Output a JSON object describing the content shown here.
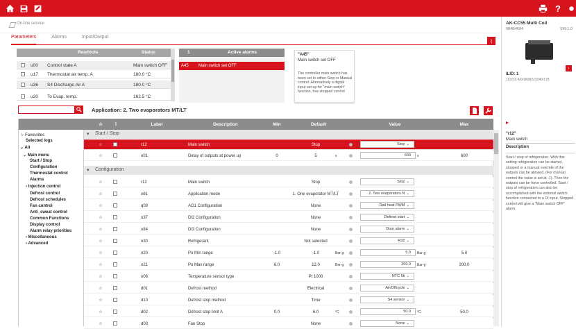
{
  "service_title": "On-line service",
  "tabs": [
    "Parameters",
    "Alarms",
    "Input/Output"
  ],
  "readouts": {
    "headers": [
      "Readouts",
      "Status"
    ],
    "rows": [
      {
        "code": "u00",
        "name": "Control state A",
        "status": "Main switch OFF"
      },
      {
        "code": "u17",
        "name": "Thermostat air temp. A",
        "status": "180.0 °C"
      },
      {
        "code": "u36",
        "name": "S4 Discharge Air A",
        "status": "180.0 °C"
      },
      {
        "code": "u20",
        "name": "To Evap. temp.",
        "status": "162.5 °C"
      }
    ]
  },
  "alarms": {
    "count": "1",
    "header": "Active alarms",
    "row": {
      "code": "A45",
      "text": "Main switch set OFF"
    },
    "detail_code": "\"A45\"",
    "detail_title": "Main switch set OFF",
    "detail_text": "The controller main switch has been set to either Stop or Manual control. Alternatively a digital input set up for \"main switch\" function, has stopped control"
  },
  "application_title": "Application: 2. Two evaporators MT/LT",
  "columns": [
    "Label",
    "Description",
    "Min",
    "Default",
    "Value",
    "Max"
  ],
  "tree": [
    "Favourites",
    "Selected logs",
    "All",
    "Main menu",
    "Start / Stop",
    "Configuration",
    "Thermostat control",
    "Alarms",
    "Injection control",
    "Defrost control",
    "Defrost schedules",
    "Fan control",
    "Anti_sweat control",
    "Common Functions",
    "Display control",
    "Alarm relay priorities",
    "Miscellaneous",
    "Advanced"
  ],
  "sections": [
    "Start / Stop",
    "Configuration"
  ],
  "rows_start": [
    {
      "label": "r12",
      "desc": "Main switch",
      "min": "",
      "def": "Stop",
      "unit": "",
      "value": "Stop",
      "max": "",
      "sel": true
    },
    {
      "label": "o01",
      "desc": "Delay of outputs at power up",
      "min": "0",
      "def": "5",
      "unit": "s",
      "value": "600",
      "vunit": "s",
      "max": "600"
    }
  ],
  "rows_config": [
    {
      "label": "r12",
      "desc": "Main switch",
      "min": "",
      "def": "Stop",
      "unit": "",
      "value": "Stop"
    },
    {
      "label": "o61",
      "desc": "Application mode",
      "min": "",
      "def": "1. One evaporator MT/LT",
      "unit": "",
      "value": "2. Two evaporators N"
    },
    {
      "label": "q09",
      "desc": "AO1 Configuration",
      "min": "",
      "def": "None",
      "unit": "",
      "value": "Rail heat PWM"
    },
    {
      "label": "o37",
      "desc": "DI2 Configuration",
      "min": "",
      "def": "None",
      "unit": "",
      "value": "Defrost start"
    },
    {
      "label": "o84",
      "desc": "DI3 Configuration",
      "min": "",
      "def": "None",
      "unit": "",
      "value": "Door alarm"
    },
    {
      "label": "o30",
      "desc": "Refrigerant",
      "min": "",
      "def": "Not selected",
      "unit": "",
      "value": "R32"
    },
    {
      "label": "o20",
      "desc": "Po Min range",
      "min": "-1.0",
      "def": "-1.0",
      "unit": "Bar-g",
      "value": "5.0",
      "vunit": "Bar-g",
      "max": "5.0"
    },
    {
      "label": "o21",
      "desc": "Po Max range",
      "min": "6.0",
      "def": "12.0",
      "unit": "Bar-g",
      "value": "200.0",
      "vunit": "Bar-g",
      "max": "200.0"
    },
    {
      "label": "o06",
      "desc": "Temperature sensor type",
      "min": "",
      "def": "Pt 1000",
      "unit": "",
      "value": "NTC 5k"
    },
    {
      "label": "d01",
      "desc": "Defrost method",
      "min": "",
      "def": "Electrical",
      "unit": "",
      "value": "Air/Offcycle"
    },
    {
      "label": "d10",
      "desc": "Defrost stop method",
      "min": "",
      "def": "Time",
      "unit": "",
      "value": "S4 sensor"
    },
    {
      "label": "d02",
      "desc": "Defrost stop limit A",
      "min": "0.0",
      "def": "6.0",
      "unit": "°C",
      "value": "50.0",
      "vunit": "°C",
      "max": "50.0"
    },
    {
      "label": "d03",
      "desc": "Fan Stop",
      "min": "",
      "def": "None",
      "unit": "",
      "value": "None"
    }
  ],
  "right_panel": {
    "product": "AK-CC55 Multi Coil",
    "code": "084B4094",
    "sw": "SW:1.0",
    "addr": "ILID: 1",
    "addr_detail": "153/10.4/0/1608/1/3240/178",
    "param_code": "\"r12\"",
    "param_name": "Main switch",
    "desc_title": "Description",
    "desc_text": "Start / stop of refrigeration. With this setting refrigeration can be started, stopped or a manual override of the outputs can be allowed. (For manual control the value is set at -1). Then the outputs can be force controlled. Start / stop of refrigeration can also be accomplished with the external switch function connected to a DI input. Stopped control will give a \"Main switch OFF\" alarm."
  }
}
